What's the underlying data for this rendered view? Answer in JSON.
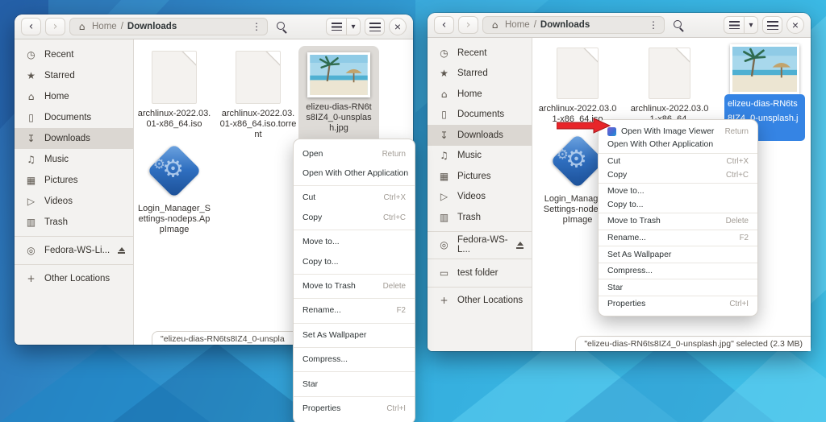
{
  "desktop": {
    "accent_blue": "#3584e4",
    "arrow_red": "#e8252a"
  },
  "left_window": {
    "header": {
      "back_icon": "‹",
      "forward_icon": "›",
      "breadcrumb_home": "Home",
      "breadcrumb_sep": "/",
      "breadcrumb_current": "Downloads",
      "path_menu_icon": "⋮",
      "view_caret_icon": "▾",
      "close_icon": "×"
    },
    "sidebar": {
      "items": [
        {
          "icon": "◷",
          "label": "Recent"
        },
        {
          "icon": "★",
          "label": "Starred"
        },
        {
          "icon": "⌂",
          "label": "Home"
        },
        {
          "icon": "▯",
          "label": "Documents"
        },
        {
          "icon": "↧",
          "label": "Downloads"
        },
        {
          "icon": "♫",
          "label": "Music"
        },
        {
          "icon": "▦",
          "label": "Pictures"
        },
        {
          "icon": "▷",
          "label": "Videos"
        },
        {
          "icon": "▥",
          "label": "Trash"
        }
      ],
      "device": {
        "icon": "◎",
        "label": "Fedora-WS-Li..."
      },
      "other_locations": {
        "icon": "+",
        "label": "Other Locations"
      }
    },
    "files": [
      {
        "name": "archlinux-2022.03.01-x86_64.iso"
      },
      {
        "name": "archlinux-2022.03.01-x86_64.iso.torrent"
      },
      {
        "name": "elizeu-dias-RN6ts8IZ4_0-unsplash.jpg"
      },
      {
        "name": "Login_Manager_Settings-nodeps.AppImage"
      }
    ],
    "context_menu": {
      "items": [
        {
          "label": "Open",
          "shortcut": "Return"
        },
        {
          "label": "Open With Other Application",
          "shortcut": ""
        },
        {
          "label": "Cut",
          "shortcut": "Ctrl+X"
        },
        {
          "label": "Copy",
          "shortcut": "Ctrl+C"
        },
        {
          "label": "Move to...",
          "shortcut": ""
        },
        {
          "label": "Copy to...",
          "shortcut": ""
        },
        {
          "label": "Move to Trash",
          "shortcut": "Delete"
        },
        {
          "label": "Rename...",
          "shortcut": "F2"
        },
        {
          "label": "Set As Wallpaper",
          "shortcut": ""
        },
        {
          "label": "Compress...",
          "shortcut": ""
        },
        {
          "label": "Star",
          "shortcut": ""
        },
        {
          "label": "Properties",
          "shortcut": "Ctrl+I"
        }
      ]
    },
    "statusbar": "\"elizeu-dias-RN6ts8IZ4_0-unspla"
  },
  "right_window": {
    "header": {
      "back_icon": "‹",
      "forward_icon": "›",
      "breadcrumb_home": "Home",
      "breadcrumb_sep": "/",
      "breadcrumb_current": "Downloads",
      "path_menu_icon": "⋮",
      "view_caret_icon": "▾",
      "close_icon": "×"
    },
    "sidebar": {
      "items": [
        {
          "icon": "◷",
          "label": "Recent"
        },
        {
          "icon": "★",
          "label": "Starred"
        },
        {
          "icon": "⌂",
          "label": "Home"
        },
        {
          "icon": "▯",
          "label": "Documents"
        },
        {
          "icon": "↧",
          "label": "Downloads"
        },
        {
          "icon": "♫",
          "label": "Music"
        },
        {
          "icon": "▦",
          "label": "Pictures"
        },
        {
          "icon": "▷",
          "label": "Videos"
        },
        {
          "icon": "▥",
          "label": "Trash"
        }
      ],
      "device": {
        "icon": "◎",
        "label": "Fedora-WS-L..."
      },
      "bookmark": {
        "icon": "▭",
        "label": "test folder"
      },
      "other_locations": {
        "icon": "+",
        "label": "Other Locations"
      }
    },
    "files": [
      {
        "name": "archlinux-2022.03.01-x86_64.iso"
      },
      {
        "name": "archlinux-2022.03.01-x86_64."
      },
      {
        "name": "elizeu-dias-RN6ts8IZ4_0-unsplash.jpg"
      },
      {
        "name": "Login_Manager_Settings-node.AppImage"
      }
    ],
    "context_menu": {
      "items": [
        {
          "label": "Open With Image Viewer",
          "shortcut": "Return"
        },
        {
          "label": "Open With Other Application",
          "shortcut": ""
        },
        {
          "label": "Cut",
          "shortcut": "Ctrl+X"
        },
        {
          "label": "Copy",
          "shortcut": "Ctrl+C"
        },
        {
          "label": "Move to...",
          "shortcut": ""
        },
        {
          "label": "Copy to...",
          "shortcut": ""
        },
        {
          "label": "Move to Trash",
          "shortcut": "Delete"
        },
        {
          "label": "Rename...",
          "shortcut": "F2"
        },
        {
          "label": "Set As Wallpaper",
          "shortcut": ""
        },
        {
          "label": "Compress...",
          "shortcut": ""
        },
        {
          "label": "Star",
          "shortcut": ""
        },
        {
          "label": "Properties",
          "shortcut": "Ctrl+I"
        }
      ]
    },
    "statusbar": "\"elizeu-dias-RN6ts8IZ4_0-unsplash.jpg\" selected (2.3 MB)"
  }
}
